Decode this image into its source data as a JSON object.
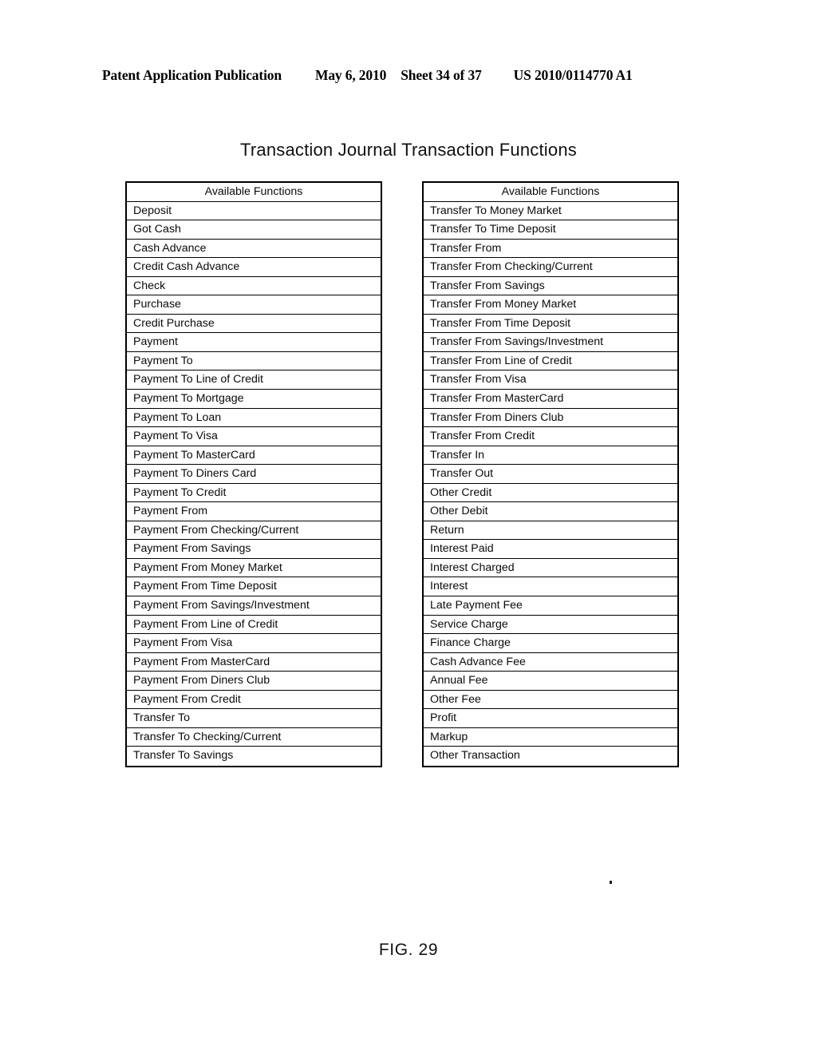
{
  "page_header": {
    "publication": "Patent Application Publication",
    "date": "May 6, 2010",
    "sheet": "Sheet 34 of 37",
    "patent_number": "US 2010/0114770 A1"
  },
  "figure": {
    "title": "Transaction Journal Transaction Functions",
    "caption": "FIG. 29"
  },
  "tables": {
    "left": {
      "header": "Available Functions",
      "rows": [
        "Deposit",
        "Got Cash",
        "Cash Advance",
        "Credit Cash Advance",
        "Check",
        "Purchase",
        "Credit Purchase",
        "Payment",
        "Payment To",
        "Payment To Line of Credit",
        "Payment To Mortgage",
        "Payment To Loan",
        "Payment To Visa",
        "Payment To MasterCard",
        "Payment To Diners Card",
        "Payment To Credit",
        "Payment From",
        "Payment From Checking/Current",
        "Payment From Savings",
        "Payment From Money Market",
        "Payment From Time Deposit",
        "Payment From Savings/Investment",
        "Payment From Line of Credit",
        "Payment From Visa",
        "Payment From MasterCard",
        "Payment From Diners Club",
        "Payment From Credit",
        "Transfer To",
        "Transfer To Checking/Current",
        "Transfer To Savings"
      ]
    },
    "right": {
      "header": "Available Functions",
      "rows": [
        "Transfer To Money Market",
        "Transfer To Time Deposit",
        "Transfer From",
        "Transfer From Checking/Current",
        "Transfer From Savings",
        "Transfer From Money Market",
        "Transfer From Time Deposit",
        "Transfer From Savings/Investment",
        "Transfer From Line of Credit",
        "Transfer From Visa",
        "Transfer From MasterCard",
        "Transfer From Diners Club",
        "Transfer From Credit",
        "Transfer In",
        "Transfer Out",
        "Other Credit",
        "Other Debit",
        "Return",
        "Interest Paid",
        "Interest Charged",
        "Interest",
        "Late Payment Fee",
        "Service Charge",
        "Finance Charge",
        "Cash Advance Fee",
        "Annual Fee",
        "Other Fee",
        "Profit",
        "Markup",
        "Other Transaction"
      ]
    }
  }
}
